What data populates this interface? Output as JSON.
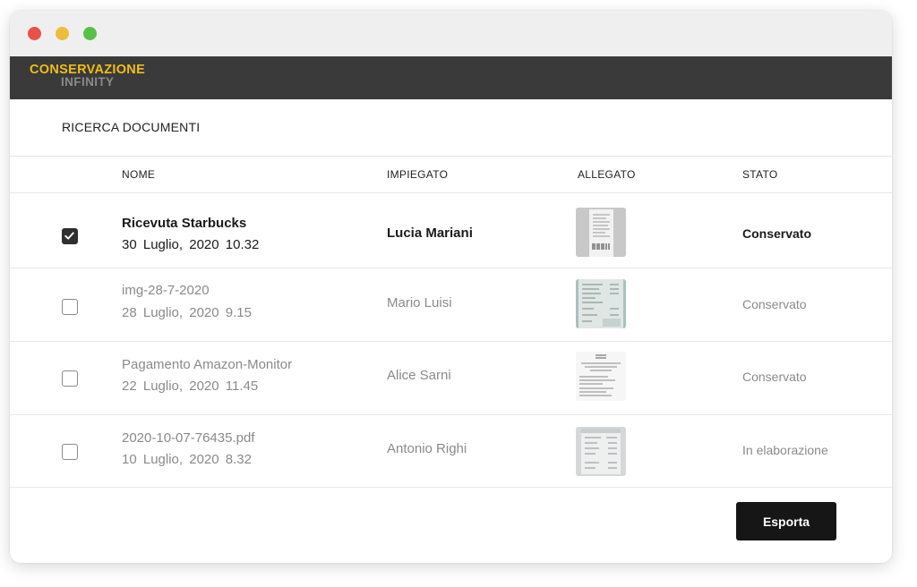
{
  "window_controls": [
    "close",
    "minimize",
    "maximize"
  ],
  "brand": {
    "line1": "CONSERVAZIONE",
    "line2": "INFINITY",
    "colors": {
      "line1": "#f2bc18",
      "line2": "#8a8a8a",
      "bar": "#3a3a3a"
    }
  },
  "page": {
    "title": "RICERCA DOCUMENTI"
  },
  "table": {
    "columns": [
      "NOME",
      "IMPIEGATO",
      "ALLEGATO",
      "STATO"
    ],
    "rows": [
      {
        "checked": true,
        "name": "Ricevuta Starbucks",
        "date": "30 Luglio, 2020 10.32",
        "employee": "Lucia Mariani",
        "attachment": "receipt-thumbnail",
        "status": "Conservato"
      },
      {
        "checked": false,
        "name": "img-28-7-2020",
        "date": "28 Luglio, 2020 9.15",
        "employee": "Mario Luisi",
        "attachment": "receipt-photo-thumbnail",
        "status": "Conservato"
      },
      {
        "checked": false,
        "name": "Pagamento Amazon-Monitor",
        "date": "22 Luglio, 2020 11.45",
        "employee": "Alice Sarni",
        "attachment": "document-thumbnail",
        "status": "Conservato"
      },
      {
        "checked": false,
        "name": "2020-10-07-76435.pdf",
        "date": "10 Luglio, 2020 8.32",
        "employee": "Antonio Righi",
        "attachment": "invoice-thumbnail",
        "status": "In elaborazione"
      }
    ]
  },
  "actions": {
    "export_label": "Esporta"
  }
}
